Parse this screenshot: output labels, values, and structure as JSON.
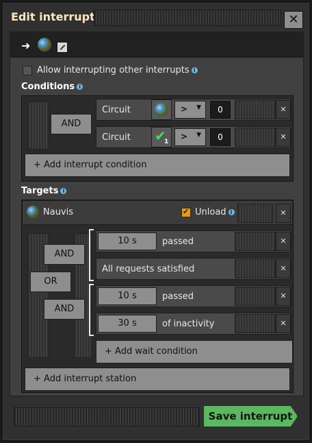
{
  "window": {
    "title": "Edit interrupt",
    "close_icon": "close-icon",
    "close_label": "✕"
  },
  "header": {
    "arrow_icon": "arrow-right-icon",
    "arrow_glyph": "➜",
    "planet_icon": "planet-nauvis-icon",
    "edit_icon": "edit-name-icon"
  },
  "allow_interrupting": {
    "label": "Allow interrupting other interrupts",
    "checked": false
  },
  "conditions": {
    "title": "Conditions",
    "and_label": "AND",
    "rows": [
      {
        "label": "Circuit",
        "signal_icon": "planet-nauvis-icon",
        "comparator": ">",
        "value": "0"
      },
      {
        "label": "Circuit",
        "signal_icon": "check-signal-icon",
        "signal_count": "1",
        "comparator": ">",
        "value": "0"
      }
    ],
    "add_label": "+ Add interrupt condition"
  },
  "targets": {
    "title": "Targets",
    "station": {
      "name": "Nauvis",
      "unload_label": "Unload",
      "unload_checked": true
    },
    "and_label_1": "AND",
    "or_label": "OR",
    "and_label_2": "AND",
    "wait_conditions": [
      {
        "button": "10 s",
        "text": "passed"
      },
      {
        "text": "All requests satisfied"
      },
      {
        "button": "10 s",
        "text": "passed"
      },
      {
        "button": "30 s",
        "text": "of inactivity"
      }
    ],
    "add_wait_label": "+ Add wait condition",
    "add_station_label": "+ Add interrupt station"
  },
  "footer": {
    "save_label": "Save interrupt"
  },
  "colors": {
    "accent_green": "#5eb663",
    "checkbox_orange": "#e39827",
    "title_color": "#ffe6c0"
  }
}
